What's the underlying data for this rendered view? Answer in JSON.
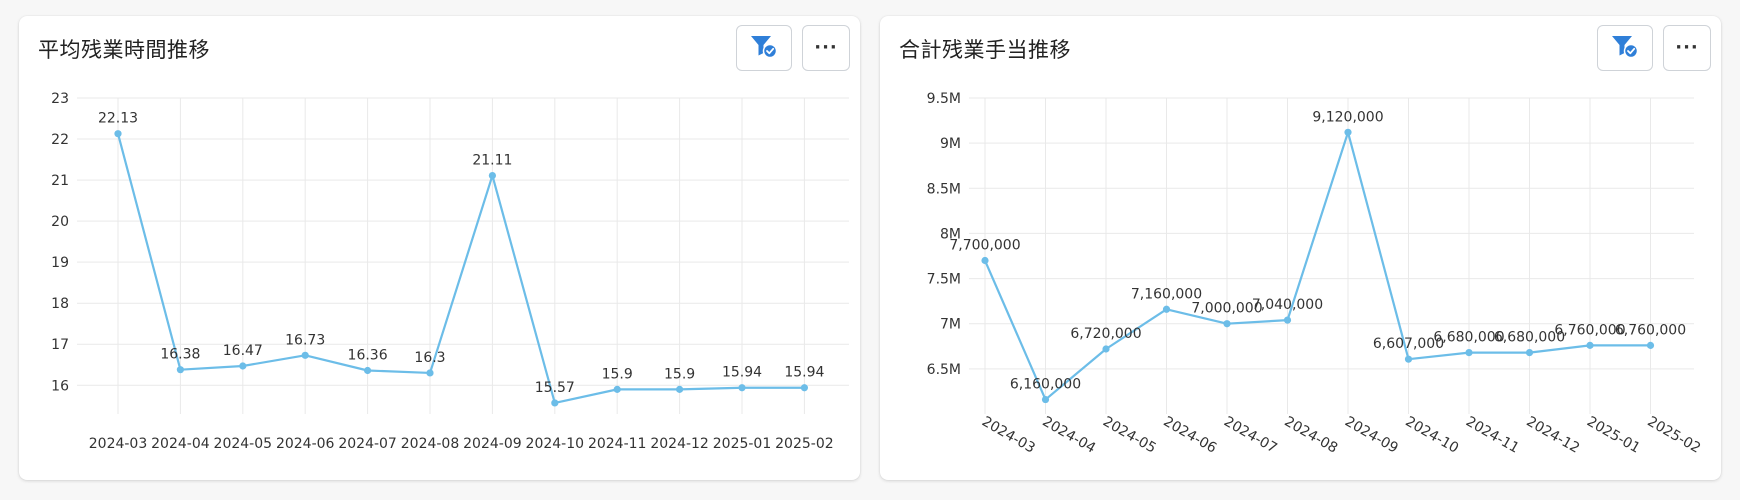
{
  "colors": {
    "line": "#6cbde8",
    "grid": "#e9e9e9",
    "accent": "#2f7fd8"
  },
  "cards": [
    {
      "title": "平均残業時間推移",
      "filter_icon": "filter-check-icon",
      "more_icon": "more-icon",
      "more_label": "···"
    },
    {
      "title": "合計残業手当推移",
      "filter_icon": "filter-check-icon",
      "more_icon": "more-icon",
      "more_label": "···"
    }
  ],
  "chart_data": [
    {
      "type": "line",
      "title": "平均残業時間推移",
      "categories": [
        "2024-03",
        "2024-04",
        "2024-05",
        "2024-06",
        "2024-07",
        "2024-08",
        "2024-09",
        "2024-10",
        "2024-11",
        "2024-12",
        "2025-01",
        "2025-02"
      ],
      "values": [
        22.13,
        16.38,
        16.47,
        16.73,
        16.36,
        16.3,
        21.11,
        15.57,
        15.9,
        15.9,
        15.94,
        15.94
      ],
      "data_labels": [
        "22.13",
        "16.38",
        "16.47",
        "16.73",
        "16.36",
        "16.3",
        "21.11",
        "15.57",
        "15.9",
        "15.9",
        "15.94",
        "15.94"
      ],
      "yticks": [
        16,
        17,
        18,
        19,
        20,
        21,
        22,
        23
      ],
      "ytick_labels": [
        "16",
        "17",
        "18",
        "19",
        "20",
        "21",
        "22",
        "23"
      ],
      "ylim": [
        15.3,
        23
      ],
      "x_label_rotation": 0,
      "grid": true
    },
    {
      "type": "line",
      "title": "合計残業手当推移",
      "categories": [
        "2024-03",
        "2024-04",
        "2024-05",
        "2024-06",
        "2024-07",
        "2024-08",
        "2024-09",
        "2024-10",
        "2024-11",
        "2024-12",
        "2025-01",
        "2025-02"
      ],
      "values": [
        7700000,
        6160000,
        6720000,
        7160000,
        7000000,
        7040000,
        9120000,
        6607000,
        6680000,
        6680000,
        6760000,
        6760000
      ],
      "data_labels": [
        "7,700,000",
        "6,160,000",
        "6,720,000",
        "7,160,000",
        "7,000,000",
        "7,040,000",
        "9,120,000",
        "6,607,000",
        "6,680,000",
        "6,680,000",
        "6,760,000",
        "6,760,000"
      ],
      "yticks": [
        6500000,
        7000000,
        7500000,
        8000000,
        8500000,
        9000000,
        9500000
      ],
      "ytick_labels": [
        "6.5M",
        "7M",
        "7.5M",
        "8M",
        "8.5M",
        "9M",
        "9.5M"
      ],
      "ylim": [
        6000000,
        9500000
      ],
      "x_label_rotation": 30,
      "grid": true
    }
  ]
}
